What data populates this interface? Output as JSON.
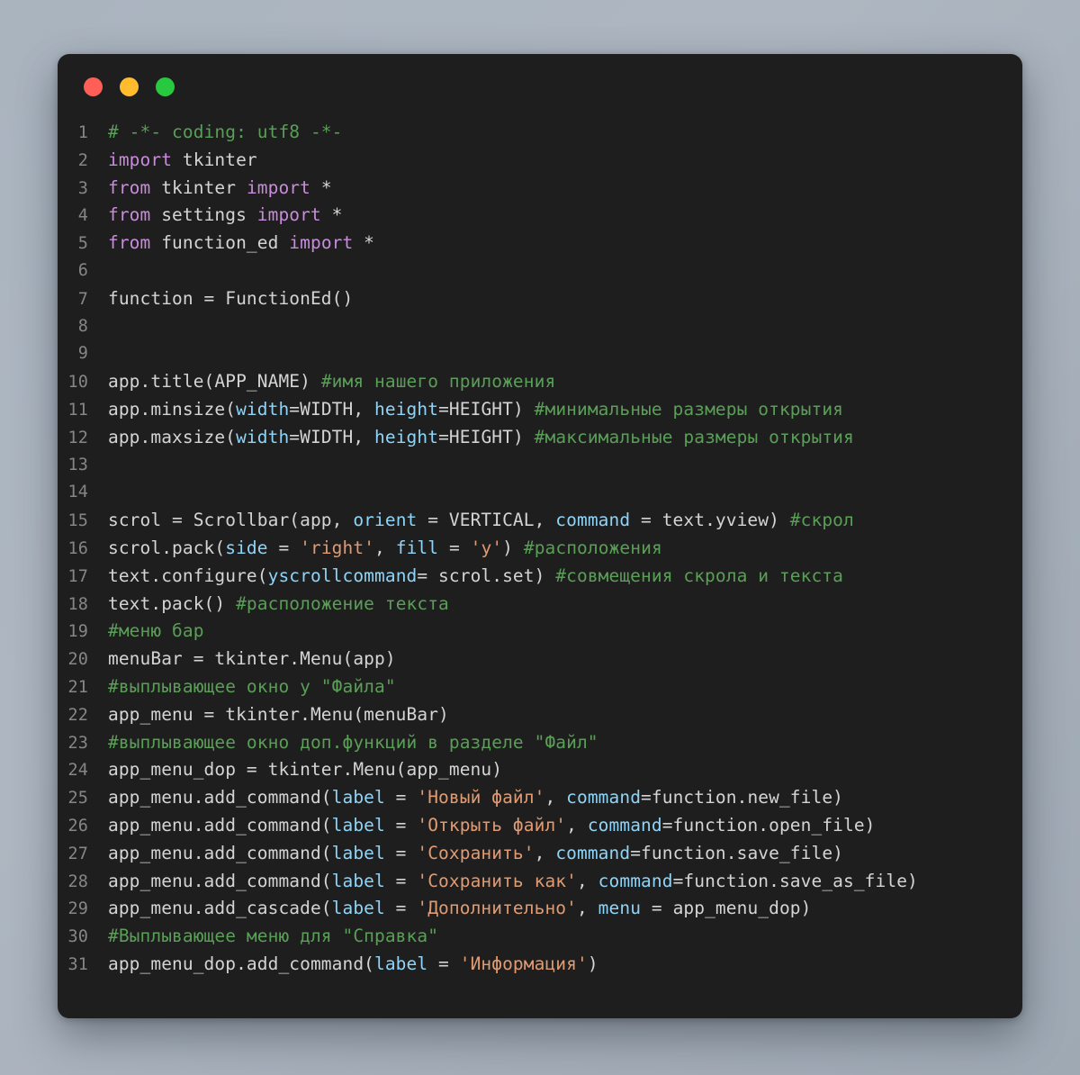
{
  "window": {
    "traffic_lights": [
      {
        "name": "close",
        "color": "#ff5f56"
      },
      {
        "name": "minimize",
        "color": "#ffbd2e"
      },
      {
        "name": "maximize",
        "color": "#27c93f"
      }
    ],
    "background": "#1e1e1e",
    "page_background": "#aeb7c1"
  },
  "theme": {
    "comment": "#5a9e57",
    "keyword": "#c98bdc",
    "argument": "#8fd4f7",
    "string": "#e09b73",
    "default_text": "#d4d4d4",
    "line_number": "#868686"
  },
  "editor": {
    "language": "python",
    "line_count": 31,
    "lines": [
      {
        "n": "1",
        "tokens": [
          {
            "t": "com",
            "s": "# -*- coding: utf8 -*-"
          }
        ]
      },
      {
        "n": "2",
        "tokens": [
          {
            "t": "kw",
            "s": "import"
          },
          {
            "t": "def",
            "s": " tkinter"
          }
        ]
      },
      {
        "n": "3",
        "tokens": [
          {
            "t": "kw",
            "s": "from"
          },
          {
            "t": "def",
            "s": " tkinter "
          },
          {
            "t": "kw",
            "s": "import"
          },
          {
            "t": "def",
            "s": " *"
          }
        ]
      },
      {
        "n": "4",
        "tokens": [
          {
            "t": "kw",
            "s": "from"
          },
          {
            "t": "def",
            "s": " settings "
          },
          {
            "t": "kw",
            "s": "import"
          },
          {
            "t": "def",
            "s": " *"
          }
        ]
      },
      {
        "n": "5",
        "tokens": [
          {
            "t": "kw",
            "s": "from"
          },
          {
            "t": "def",
            "s": " function_ed "
          },
          {
            "t": "kw",
            "s": "import"
          },
          {
            "t": "def",
            "s": " *"
          }
        ]
      },
      {
        "n": "6",
        "tokens": []
      },
      {
        "n": "7",
        "tokens": [
          {
            "t": "def",
            "s": "function = FunctionEd()"
          }
        ]
      },
      {
        "n": "8",
        "tokens": []
      },
      {
        "n": "9",
        "tokens": []
      },
      {
        "n": "10",
        "tokens": [
          {
            "t": "def",
            "s": "app.title(APP_NAME) "
          },
          {
            "t": "com",
            "s": "#имя нашего приложения"
          }
        ]
      },
      {
        "n": "11",
        "tokens": [
          {
            "t": "def",
            "s": "app.minsize("
          },
          {
            "t": "arg",
            "s": "width"
          },
          {
            "t": "def",
            "s": "=WIDTH, "
          },
          {
            "t": "arg",
            "s": "height"
          },
          {
            "t": "def",
            "s": "=HEIGHT) "
          },
          {
            "t": "com",
            "s": "#минимальные размеры открытия"
          }
        ]
      },
      {
        "n": "12",
        "tokens": [
          {
            "t": "def",
            "s": "app.maxsize("
          },
          {
            "t": "arg",
            "s": "width"
          },
          {
            "t": "def",
            "s": "=WIDTH, "
          },
          {
            "t": "arg",
            "s": "height"
          },
          {
            "t": "def",
            "s": "=HEIGHT) "
          },
          {
            "t": "com",
            "s": "#максимальные размеры открытия"
          }
        ]
      },
      {
        "n": "13",
        "tokens": []
      },
      {
        "n": "14",
        "tokens": []
      },
      {
        "n": "15",
        "tokens": [
          {
            "t": "def",
            "s": "scrol = Scrollbar(app, "
          },
          {
            "t": "arg",
            "s": "orient"
          },
          {
            "t": "def",
            "s": " = VERTICAL, "
          },
          {
            "t": "arg",
            "s": "command"
          },
          {
            "t": "def",
            "s": " = text.yview) "
          },
          {
            "t": "com",
            "s": "#скрол"
          }
        ]
      },
      {
        "n": "16",
        "tokens": [
          {
            "t": "def",
            "s": "scrol.pack("
          },
          {
            "t": "arg",
            "s": "side"
          },
          {
            "t": "def",
            "s": " = "
          },
          {
            "t": "str",
            "s": "'right'"
          },
          {
            "t": "def",
            "s": ", "
          },
          {
            "t": "arg",
            "s": "fill"
          },
          {
            "t": "def",
            "s": " = "
          },
          {
            "t": "str",
            "s": "'y'"
          },
          {
            "t": "def",
            "s": ") "
          },
          {
            "t": "com",
            "s": "#расположения"
          }
        ]
      },
      {
        "n": "17",
        "tokens": [
          {
            "t": "def",
            "s": "text.configure("
          },
          {
            "t": "arg",
            "s": "yscrollcommand"
          },
          {
            "t": "def",
            "s": "= scrol.set) "
          },
          {
            "t": "com",
            "s": "#совмещения скрола и текста"
          }
        ]
      },
      {
        "n": "18",
        "tokens": [
          {
            "t": "def",
            "s": "text.pack() "
          },
          {
            "t": "com",
            "s": "#расположение текста"
          }
        ]
      },
      {
        "n": "19",
        "tokens": [
          {
            "t": "com",
            "s": "#меню бар"
          }
        ]
      },
      {
        "n": "20",
        "tokens": [
          {
            "t": "def",
            "s": "menuBar = tkinter.Menu(app)"
          }
        ]
      },
      {
        "n": "21",
        "tokens": [
          {
            "t": "com",
            "s": "#выплывающее окно у \"Файла\""
          }
        ]
      },
      {
        "n": "22",
        "tokens": [
          {
            "t": "def",
            "s": "app_menu = tkinter.Menu(menuBar)"
          }
        ]
      },
      {
        "n": "23",
        "tokens": [
          {
            "t": "com",
            "s": "#выплывающее окно доп.функций в разделе \"Файл\""
          }
        ]
      },
      {
        "n": "24",
        "tokens": [
          {
            "t": "def",
            "s": "app_menu_dop = tkinter.Menu(app_menu)"
          }
        ]
      },
      {
        "n": "25",
        "tokens": [
          {
            "t": "def",
            "s": "app_menu.add_command("
          },
          {
            "t": "arg",
            "s": "label"
          },
          {
            "t": "def",
            "s": " = "
          },
          {
            "t": "str",
            "s": "'Новый файл'"
          },
          {
            "t": "def",
            "s": ", "
          },
          {
            "t": "arg",
            "s": "command"
          },
          {
            "t": "def",
            "s": "=function.new_file)"
          }
        ]
      },
      {
        "n": "26",
        "tokens": [
          {
            "t": "def",
            "s": "app_menu.add_command("
          },
          {
            "t": "arg",
            "s": "label"
          },
          {
            "t": "def",
            "s": " = "
          },
          {
            "t": "str",
            "s": "'Открыть файл'"
          },
          {
            "t": "def",
            "s": ", "
          },
          {
            "t": "arg",
            "s": "command"
          },
          {
            "t": "def",
            "s": "=function.open_file)"
          }
        ]
      },
      {
        "n": "27",
        "tokens": [
          {
            "t": "def",
            "s": "app_menu.add_command("
          },
          {
            "t": "arg",
            "s": "label"
          },
          {
            "t": "def",
            "s": " = "
          },
          {
            "t": "str",
            "s": "'Сохранить'"
          },
          {
            "t": "def",
            "s": ", "
          },
          {
            "t": "arg",
            "s": "command"
          },
          {
            "t": "def",
            "s": "=function.save_file)"
          }
        ]
      },
      {
        "n": "28",
        "tokens": [
          {
            "t": "def",
            "s": "app_menu.add_command("
          },
          {
            "t": "arg",
            "s": "label"
          },
          {
            "t": "def",
            "s": " = "
          },
          {
            "t": "str",
            "s": "'Сохранить как'"
          },
          {
            "t": "def",
            "s": ", "
          },
          {
            "t": "arg",
            "s": "command"
          },
          {
            "t": "def",
            "s": "=function.save_as_file)"
          }
        ]
      },
      {
        "n": "29",
        "tokens": [
          {
            "t": "def",
            "s": "app_menu.add_cascade("
          },
          {
            "t": "arg",
            "s": "label"
          },
          {
            "t": "def",
            "s": " = "
          },
          {
            "t": "str",
            "s": "'Дополнительно'"
          },
          {
            "t": "def",
            "s": ", "
          },
          {
            "t": "arg",
            "s": "menu"
          },
          {
            "t": "def",
            "s": " = app_menu_dop)"
          }
        ]
      },
      {
        "n": "30",
        "tokens": [
          {
            "t": "com",
            "s": "#Выплывающее меню для \"Справка\""
          }
        ]
      },
      {
        "n": "31",
        "tokens": [
          {
            "t": "def",
            "s": "app_menu_dop.add_command("
          },
          {
            "t": "arg",
            "s": "label"
          },
          {
            "t": "def",
            "s": " = "
          },
          {
            "t": "str",
            "s": "'Информация'"
          },
          {
            "t": "def",
            "s": ")"
          }
        ]
      }
    ]
  }
}
